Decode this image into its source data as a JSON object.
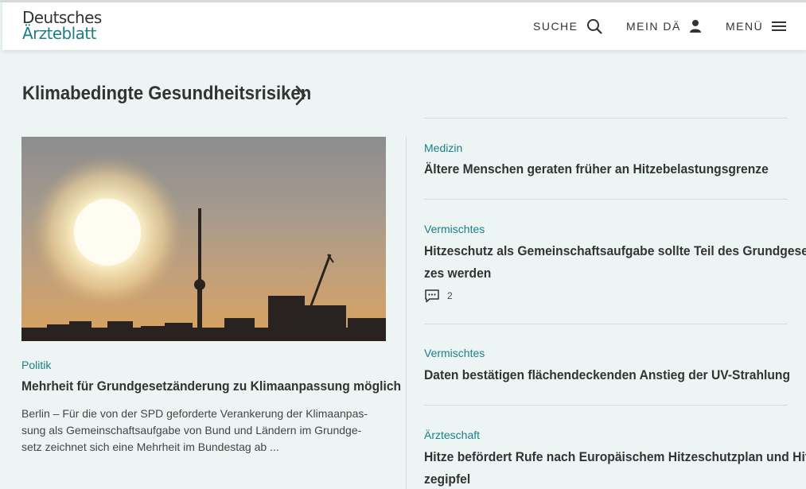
{
  "header": {
    "logo_line1": "Deutsches",
    "logo_line2": "Ärzteblatt",
    "search_label": "SUCHE",
    "account_label": "MEIN DÄ",
    "menu_label": "MENÜ"
  },
  "section": {
    "title": "Klimabedingte Gesundheitsrisiken"
  },
  "lead": {
    "category": "Politik",
    "title": "Mehrheit für Grundgesetzänderung zu Klimaanpassung möglich",
    "teaser_lines": [
      "Berlin – Für die von der SPD geforderte Verankerung der Klimaanpas-",
      "sung als Gemeinschaftsaufgabe von Bund und Ländern im Grundge-",
      "setz zeichnet sich eine Mehrheit im Bundestag ab ..."
    ]
  },
  "articles": [
    {
      "category": "Medizin",
      "title_lines": [
        "Ältere Menschen geraten früher an Hitzebelastungsgrenze"
      ]
    },
    {
      "category": "Vermischtes",
      "title_lines": [
        "Hitzeschutz als Gemeinschaftsaufgabe sollte Teil des Grundgeset-",
        "zes werden"
      ],
      "comments": "2"
    },
    {
      "category": "Vermischtes",
      "title_lines": [
        "Daten bestätigen flächendeckenden Anstieg der UV-Strahlung"
      ]
    },
    {
      "category": "Ärzteschaft",
      "title_lines": [
        "Hitze befördert Rufe nach Europäischem Hitzeschutzplan und Hit-",
        "zegipfel"
      ]
    }
  ],
  "colors": {
    "accent": "#1b7f86",
    "background": "#edf5f4",
    "text": "#333333"
  },
  "icons": {
    "search": "search-icon",
    "account": "user-icon",
    "menu": "hamburger-icon",
    "section_link": "chevron-right-icon",
    "comments": "comment-icon"
  }
}
